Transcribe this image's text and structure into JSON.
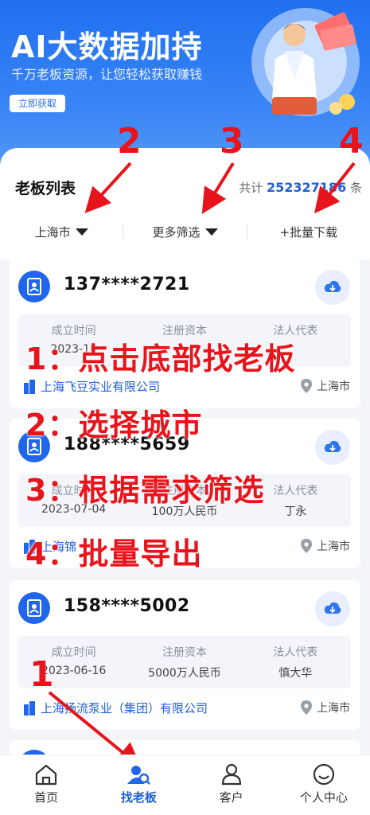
{
  "hero": {
    "title": "AI大数据加持",
    "subtitle": "千万老板资源，让您轻松获取赚钱",
    "cta": "立即获取"
  },
  "list": {
    "title": "老板列表",
    "total_prefix": "共计",
    "total_count": "252327186",
    "total_suffix": "条",
    "filters": {
      "city": "上海市",
      "more": "更多筛选",
      "batch_download": "+批量下载"
    }
  },
  "cards": [
    {
      "phone": "137****2721",
      "labels": [
        "成立时间",
        "注册资本",
        "法人代表"
      ],
      "values": [
        "2023-10",
        "",
        ""
      ],
      "company": "上海飞豆实业有限公司",
      "location": "上海市"
    },
    {
      "phone": "188****5659",
      "labels": [
        "成立时间",
        "注册资本",
        "法人代表"
      ],
      "values": [
        "2023-07-04",
        "100万人民币",
        "丁永"
      ],
      "company": "上海锦",
      "location": "上海市"
    },
    {
      "phone": "158****5002",
      "labels": [
        "成立时间",
        "注册资本",
        "法人代表"
      ],
      "values": [
        "2023-06-16",
        "5000万人民币",
        "慎大华"
      ],
      "company": "上海扬流泵业（集团）有限公司",
      "location": "上海市"
    }
  ],
  "overlay": {
    "steps": [
      "1：点击底部找老板",
      "2：选择城市",
      "3：根据需求筛选",
      "4：批量导出"
    ],
    "markers": [
      "2",
      "3",
      "4",
      "1"
    ]
  },
  "tabbar": {
    "items": [
      {
        "label": "首页",
        "icon": "home-icon"
      },
      {
        "label": "找老板",
        "icon": "find-boss-icon"
      },
      {
        "label": "客户",
        "icon": "customer-icon"
      },
      {
        "label": "个人中心",
        "icon": "profile-icon"
      }
    ]
  },
  "colors": {
    "accent": "#1f66ea",
    "annotation": "#e8141c"
  }
}
